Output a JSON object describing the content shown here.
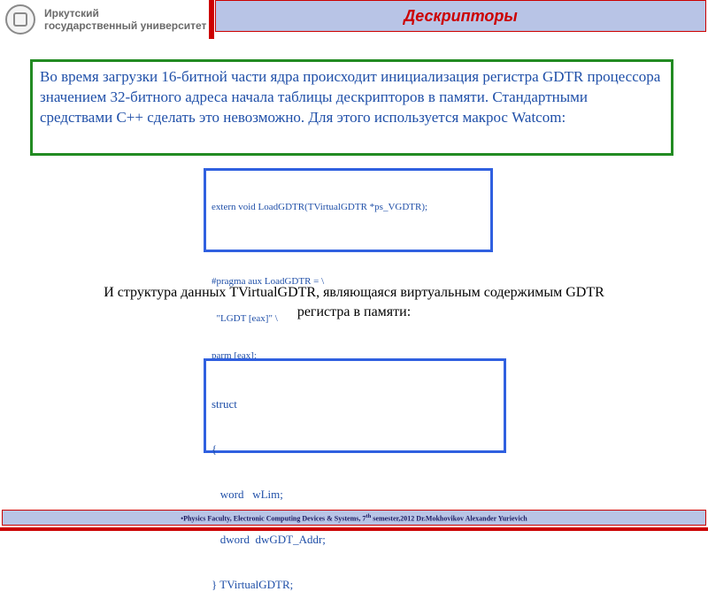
{
  "header": {
    "logo_line1": "Иркутский",
    "logo_line2": "государственный университет",
    "title": "Дескрипторы"
  },
  "intro": {
    "text": "Во время загрузки 16-битной части ядра происходит инициализация регистра GDTR процессора значением 32-битного адреса начала таблицы дескрипторов в памяти. Стандартными средствами C++ сделать это невозможно. Для этого используется макрос Watcom:"
  },
  "code1": {
    "lines": [
      "extern void LoadGDTR(TVirtualGDTR *ps_VGDTR);",
      "",
      "#pragma aux LoadGDTR = \\",
      "  \"LGDT [eax]\" \\",
      "parm [eax];"
    ]
  },
  "struct_caption": {
    "line1": "И структура данных TVirtualGDTR, являющаяся виртуальным содержимым GDTR",
    "line2": "регистра в памяти:"
  },
  "code2": {
    "lines": [
      "struct",
      "{",
      "   word   wLim;",
      "   dword  dwGDT_Addr;",
      "} TVirtualGDTR;"
    ]
  },
  "footer": {
    "prefix": "•Physics Faculty, Electronic Computing Devices & Systems, 7",
    "superscript": "th",
    "suffix": " semester,2012 Dr.Mokhovikov Alexander Yurievich"
  },
  "colors": {
    "title_bar_bg": "#b8c4e6",
    "accent_red": "#cc0000",
    "intro_border": "#228b22",
    "code_border": "#3060e0",
    "text_blue": "#1f4fa8"
  },
  "icons": {
    "logo": "university-emblem-icon"
  }
}
